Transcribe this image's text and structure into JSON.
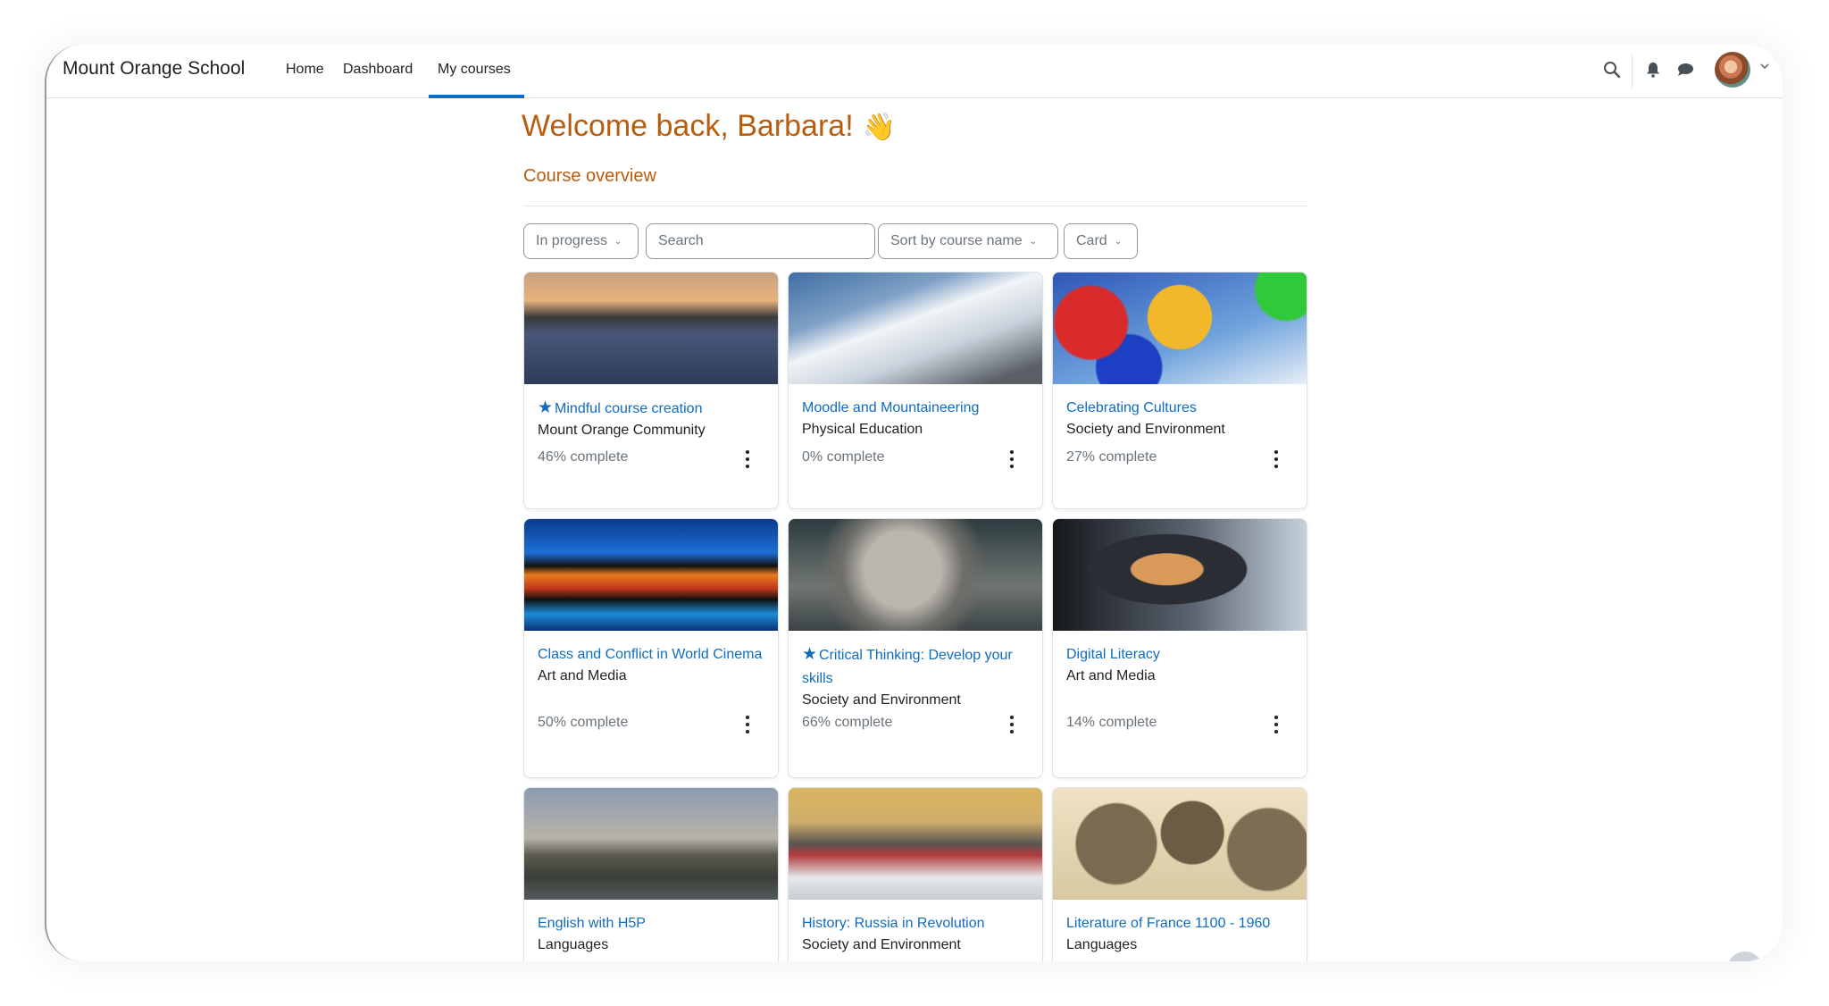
{
  "navbar": {
    "brand": "Mount Orange School",
    "links": [
      {
        "label": "Home",
        "active": false
      },
      {
        "label": "Dashboard",
        "active": false
      },
      {
        "label": "My courses",
        "active": true
      }
    ],
    "icons": [
      "search-icon",
      "bell-icon",
      "chat-icon"
    ],
    "active_color": "#0f6cbf"
  },
  "page": {
    "welcome": "Welcome back, Barbara!",
    "wave_emoji": "👋",
    "section_title": "Course overview",
    "accent_color": "#b85c0f"
  },
  "controls": {
    "grouping": "In progress",
    "search_placeholder": "Search",
    "search_value": "",
    "sort": "Sort by course name",
    "view": "Card"
  },
  "courses": [
    {
      "title": "Mindful course creation",
      "category": "Mount Orange Community",
      "progress": "46% complete",
      "starred": true,
      "image": "lake-swans-sunset"
    },
    {
      "title": "Moodle and Mountaineering",
      "category": "Physical Education",
      "progress": "0% complete",
      "starred": false,
      "image": "snowy-mountain"
    },
    {
      "title": "Celebrating Cultures",
      "category": "Society and Environment",
      "progress": "27% complete",
      "starred": false,
      "image": "colorful-umbrellas"
    },
    {
      "title": "Class and Conflict in World Cinema",
      "category": "Art and Media",
      "progress": "50% complete",
      "starred": false,
      "image": "film-strip"
    },
    {
      "title": "Critical Thinking: Develop your skills",
      "category": "Society and Environment",
      "progress": "66% complete",
      "starred": true,
      "image": "thinker-statue"
    },
    {
      "title": "Digital Literacy",
      "category": "Art and Media",
      "progress": "14% complete",
      "starred": false,
      "image": "laptop-bookshelf"
    },
    {
      "title": "English with H5P",
      "category": "Languages",
      "progress": "",
      "starred": false,
      "image": "london-westminster"
    },
    {
      "title": "History: Russia in Revolution",
      "category": "Society and Environment",
      "progress": "",
      "starred": false,
      "image": "horse-carriage-snow"
    },
    {
      "title": "Literature of France 1100 - 1960",
      "category": "Languages",
      "progress": "",
      "starred": false,
      "image": "engraved-portraits"
    }
  ]
}
